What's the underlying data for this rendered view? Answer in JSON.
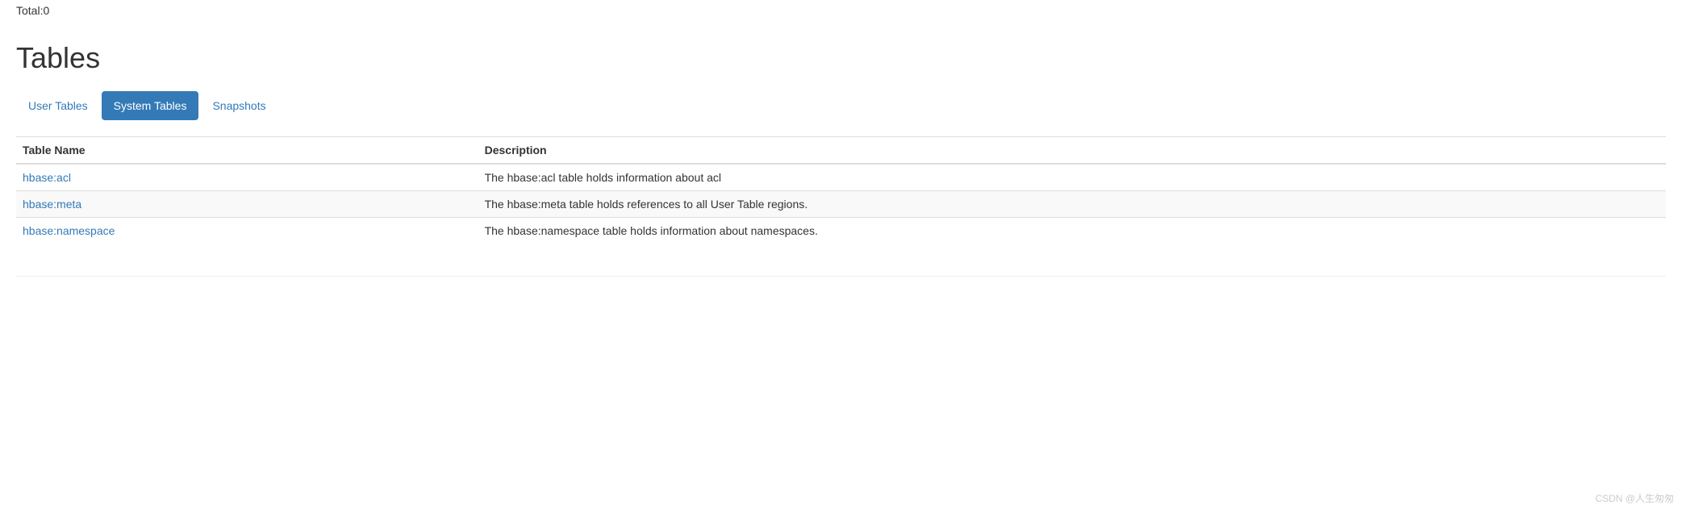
{
  "total": "Total:0",
  "section_title": "Tables",
  "tabs": [
    {
      "label": "User Tables",
      "active": false
    },
    {
      "label": "System Tables",
      "active": true
    },
    {
      "label": "Snapshots",
      "active": false
    }
  ],
  "table": {
    "headers": {
      "name": "Table Name",
      "description": "Description"
    },
    "rows": [
      {
        "name": "hbase:acl",
        "description": "The hbase:acl table holds information about acl"
      },
      {
        "name": "hbase:meta",
        "description": "The hbase:meta table holds references to all User Table regions."
      },
      {
        "name": "hbase:namespace",
        "description": "The hbase:namespace table holds information about namespaces."
      }
    ]
  },
  "watermark": "CSDN @人生匆匆"
}
